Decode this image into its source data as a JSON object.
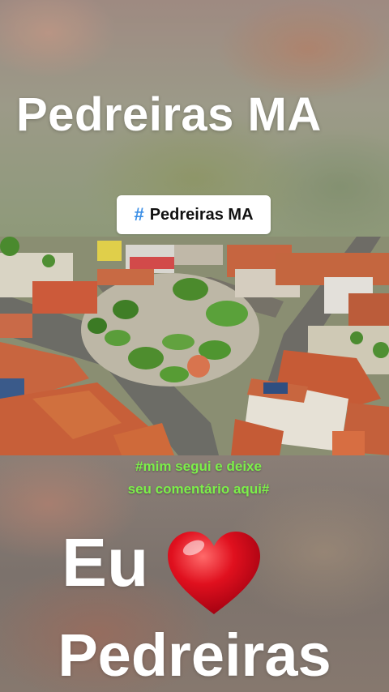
{
  "top": {
    "title": "Pedreiras MA",
    "hashtag_icon": "#",
    "hashtag_label": "Pedreiras MA"
  },
  "photo": {
    "description_icon": "aerial-town-square-photo"
  },
  "caption": {
    "line1": "#mim segui e deixe",
    "line2": "seu comentário aqui#"
  },
  "bottom": {
    "eu": "Eu",
    "heart_icon": "red-heart-emoji",
    "city": "Pedreiras"
  },
  "colors": {
    "caption": "#7cf04a",
    "hashtag_icon": "#3a8ee6",
    "heart": "#e0101e"
  }
}
